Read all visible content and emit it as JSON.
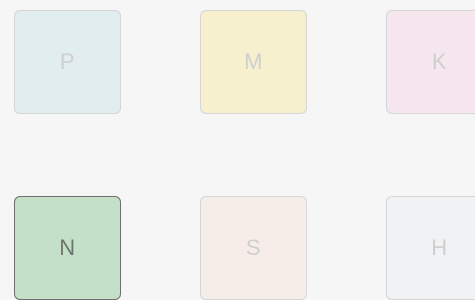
{
  "tiles": [
    {
      "letter": "P",
      "color": "#e2edf0",
      "selected": false
    },
    {
      "letter": "M",
      "color": "#f6f0cf",
      "selected": false
    },
    {
      "letter": "K",
      "color": "#f6e6ee",
      "selected": false
    },
    {
      "letter": "N",
      "color": "#c4e0c8",
      "selected": true
    },
    {
      "letter": "S",
      "color": "#f6ede8",
      "selected": false
    },
    {
      "letter": "H",
      "color": "#f1f2f4",
      "selected": false
    }
  ]
}
